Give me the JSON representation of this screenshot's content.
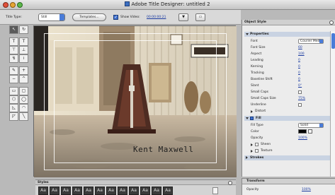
{
  "window": {
    "title": "Adobe Title Designer: untitled 2"
  },
  "toolbar": {
    "title_type_label": "Title Type:",
    "title_type_value": "Still",
    "templates_label": "Templates...",
    "show_video_label": "Show Video:",
    "show_video_checked": true,
    "timecode": "00:00:00:21",
    "marker_glyph": "▼",
    "frame_glyph": "▭"
  },
  "tools": [
    {
      "id": "selection",
      "glyph": "↖",
      "selected": true
    },
    {
      "id": "rotation",
      "glyph": "↻",
      "selected": false
    },
    {
      "id": "type",
      "glyph": "T",
      "selected": false
    },
    {
      "id": "vertical-type",
      "glyph": "T",
      "selected": false
    },
    {
      "id": "area-type",
      "glyph": "⊤",
      "selected": false
    },
    {
      "id": "vertical-area-type",
      "glyph": "⊥",
      "selected": false
    },
    {
      "id": "path-type",
      "glyph": "↯",
      "selected": false
    },
    {
      "id": "vertical-path-type",
      "glyph": "≀",
      "selected": false
    },
    {
      "id": "pen",
      "glyph": "✎",
      "selected": false
    },
    {
      "id": "add-anchor",
      "glyph": "+",
      "selected": false
    },
    {
      "id": "delete-anchor",
      "glyph": "−",
      "selected": false
    },
    {
      "id": "convert-anchor",
      "glyph": "^",
      "selected": false
    },
    {
      "id": "rectangle",
      "glyph": "▭",
      "selected": false
    },
    {
      "id": "rounded-rectangle",
      "glyph": "▢",
      "selected": false
    },
    {
      "id": "clipped-rectangle",
      "glyph": "⬡",
      "selected": false
    },
    {
      "id": "ellipse",
      "glyph": "◯",
      "selected": false
    },
    {
      "id": "wedge",
      "glyph": "◺",
      "selected": false
    },
    {
      "id": "arc",
      "glyph": "◠",
      "selected": false
    },
    {
      "id": "polygon",
      "glyph": "◸",
      "selected": false
    },
    {
      "id": "line",
      "glyph": "╲",
      "selected": false
    }
  ],
  "canvas": {
    "title_text": "Kent Maxwell"
  },
  "object_style": {
    "panel_title": "Object Style",
    "properties_label": "Properties",
    "rows": [
      {
        "label": "Font",
        "kind": "drop",
        "value": "Courier Medi"
      },
      {
        "label": "Font Size",
        "kind": "val",
        "value": "60"
      },
      {
        "label": "Aspect",
        "kind": "val",
        "value": "100"
      },
      {
        "label": "Leading",
        "kind": "val",
        "value": "0"
      },
      {
        "label": "Kerning",
        "kind": "val",
        "value": "0"
      },
      {
        "label": "Tracking",
        "kind": "val",
        "value": "0"
      },
      {
        "label": "Baseline Shift",
        "kind": "val",
        "value": "0"
      },
      {
        "label": "Slant",
        "kind": "val",
        "value": "0°"
      },
      {
        "label": "Small Caps",
        "kind": "cb",
        "value": ""
      },
      {
        "label": "Small Caps Size",
        "kind": "val",
        "value": "75%"
      },
      {
        "label": "Underline",
        "kind": "cb",
        "value": ""
      },
      {
        "label": "Distort",
        "kind": "sub",
        "value": ""
      }
    ],
    "fill_label": "Fill",
    "fill_checked": true,
    "fill_rows": [
      {
        "label": "Fill Type",
        "kind": "drop",
        "value": "Solid"
      },
      {
        "label": "Color",
        "kind": "swatch",
        "value": ""
      },
      {
        "label": "Opacity",
        "kind": "val",
        "value": "100%"
      },
      {
        "label": "Sheen",
        "kind": "subcb",
        "value": ""
      },
      {
        "label": "Texture",
        "kind": "subcb",
        "value": ""
      }
    ],
    "strokes_label": "Strokes",
    "colors": {
      "fill_color": "#000000"
    }
  },
  "styles_panel": {
    "title": "Styles",
    "swatch_glyph": "Aa"
  },
  "transform_panel": {
    "title": "Transform",
    "opacity_label": "Opacity",
    "opacity_value": "100%"
  }
}
